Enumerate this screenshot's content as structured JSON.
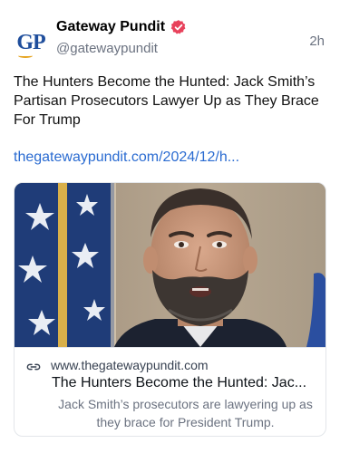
{
  "post": {
    "author": {
      "display_name": "Gateway Pundit",
      "handle": "@gatewaypundit",
      "avatar_text": "GP",
      "verified_icon": "verified-badge-icon"
    },
    "timestamp": "2h",
    "text": "The Hunters Become the Hunted: Jack Smith’s Partisan Prosecutors Lawyer Up as They Brace For Trump",
    "link_text": "thegatewaypundit.com/2024/12/h..."
  },
  "link_card": {
    "icon": "link-icon",
    "domain": "www.thegatewaypundit.com",
    "title": "The Hunters Become the Hunted: Jac...",
    "description": "Jack Smith’s prosecutors are lawyering up as they brace for President Trump."
  },
  "colors": {
    "brand_blue": "#1f4e9c",
    "link": "#2a6bd1",
    "verified_badge": "#e8415b",
    "secondary_text": "#6b7280"
  }
}
